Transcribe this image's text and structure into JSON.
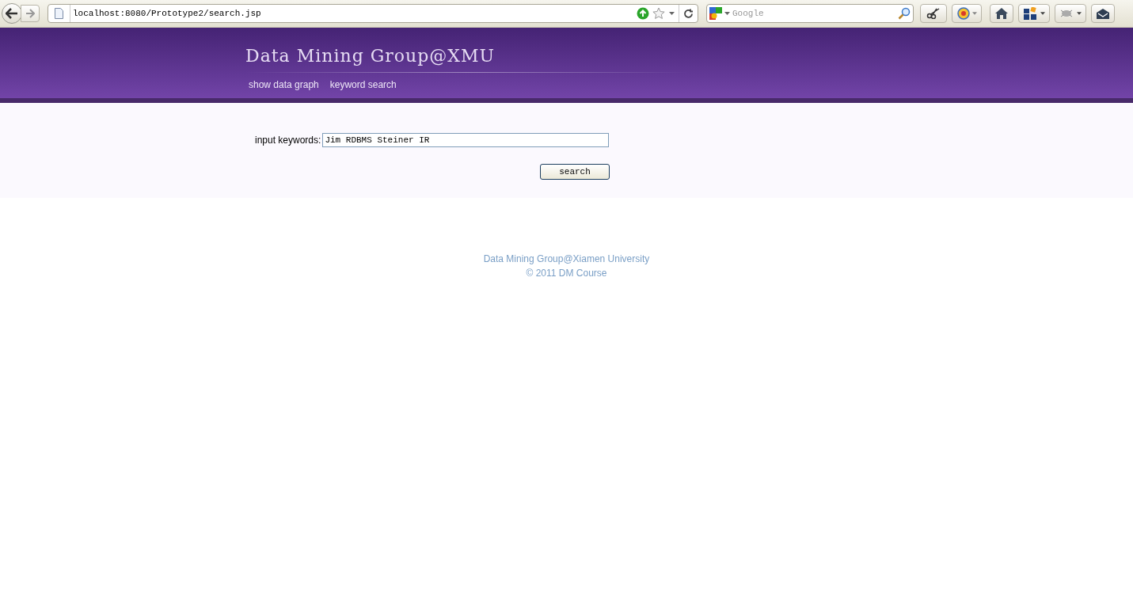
{
  "browser": {
    "url": "localhost:8080/Prototype2/search.jsp",
    "search_placeholder": "Google"
  },
  "header": {
    "title": "Data Mining Group@XMU",
    "nav": [
      {
        "label": "show data graph"
      },
      {
        "label": "keyword search"
      }
    ]
  },
  "form": {
    "label": "input keywords:",
    "value": "Jim RDBMS Steiner IR",
    "button": "search"
  },
  "footer": [
    "Data Mining Group@Xiamen University",
    "© 2011 DM Course"
  ]
}
